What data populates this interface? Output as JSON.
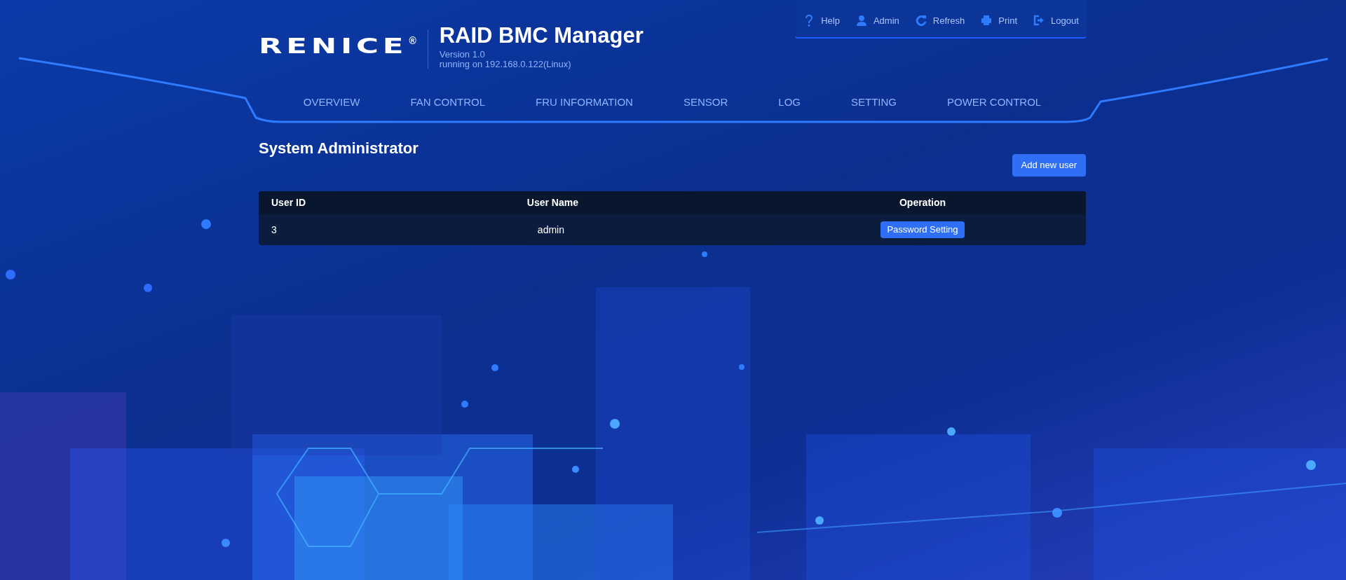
{
  "header": {
    "logo": {
      "text": "RENICE",
      "mark": "®"
    },
    "title": "RAID BMC Manager",
    "version": "Version 1.0",
    "host": "running on 192.168.0.122(Linux)"
  },
  "toolbar": [
    {
      "kind": "help",
      "label": "Help"
    },
    {
      "kind": "user",
      "label": "Admin"
    },
    {
      "kind": "refresh",
      "label": "Refresh"
    },
    {
      "kind": "print",
      "label": "Print"
    },
    {
      "kind": "logout",
      "label": "Logout"
    }
  ],
  "nav": [
    {
      "label": "OVERVIEW"
    },
    {
      "label": "FAN CONTROL"
    },
    {
      "label": "FRU INFORMATION"
    },
    {
      "label": "SENSOR"
    },
    {
      "label": "LOG"
    },
    {
      "label": "SETTING"
    },
    {
      "label": "POWER CONTROL"
    }
  ],
  "page": {
    "title": "System Administrator",
    "add_button": "Add new user"
  },
  "table": {
    "columns": [
      "User ID",
      "User Name",
      "Operation"
    ],
    "rows": [
      {
        "user_id": "3",
        "user_name": "admin",
        "operation": "Password Setting"
      }
    ]
  }
}
